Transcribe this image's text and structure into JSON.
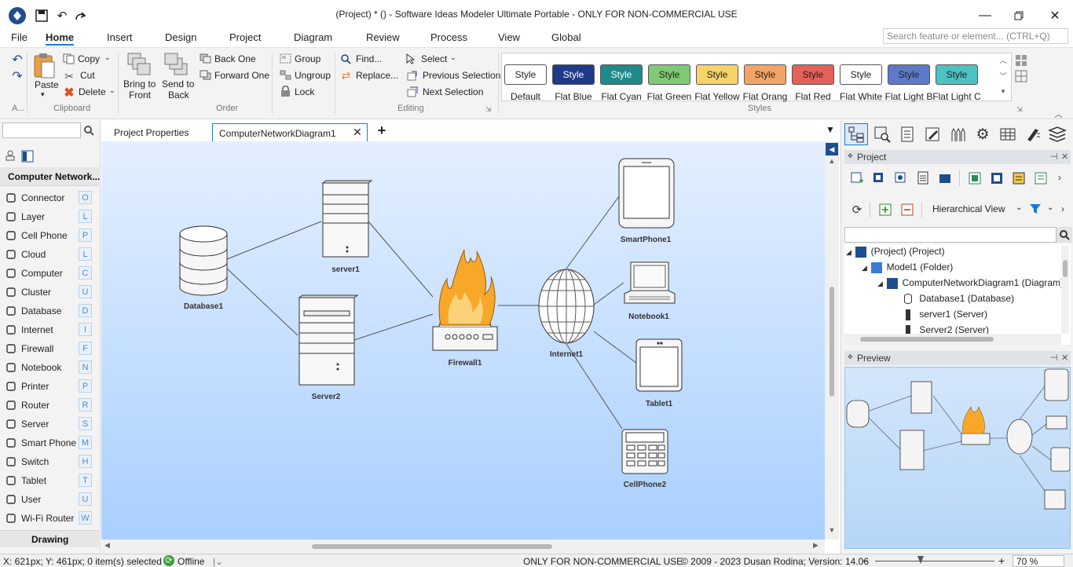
{
  "window": {
    "title": "(Project) *  ()  - Software Ideas Modeler Ultimate Portable - ONLY FOR NON-COMMERCIAL USE",
    "controls": [
      "minimize",
      "maximize",
      "close"
    ]
  },
  "menu": {
    "items": [
      "File",
      "Home",
      "Insert",
      "Design",
      "Project",
      "Diagram",
      "Review",
      "Process",
      "View",
      "Global"
    ],
    "active": "Home",
    "search_placeholder": "Search feature or element... (CTRL+Q)"
  },
  "ribbon": {
    "undo_group_label": "A...",
    "paste_label": "Paste",
    "copy_label": "Copy",
    "cut_label": "Cut",
    "delete_label": "Delete",
    "clipboard_label": "Clipboard",
    "bring_front_label_1": "Bring to",
    "bring_front_label_2": "Front",
    "send_back_label_1": "Send to",
    "send_back_label_2": "Back",
    "back_one_label": "Back One",
    "forward_one_label": "Forward One",
    "group_label": "Group",
    "ungroup_label": "Ungroup",
    "lock_label": "Lock",
    "order_label": "Order",
    "find_label": "Find...",
    "replace_label": "Replace...",
    "select_label": "Select",
    "prev_selection_label": "Previous Selection",
    "next_selection_label": "Next Selection",
    "editing_label": "Editing",
    "styles_label": "Styles",
    "style_button_text": "Style",
    "styles": [
      {
        "name": "Default",
        "bg": "#ffffff",
        "fg": "#222222"
      },
      {
        "name": "Flat Blue",
        "bg": "#203a8a",
        "fg": "#ffffff"
      },
      {
        "name": "Flat Cyan",
        "bg": "#1e8a8a",
        "fg": "#ffffff"
      },
      {
        "name": "Flat Green",
        "bg": "#7fca74",
        "fg": "#222222"
      },
      {
        "name": "Flat Yellow",
        "bg": "#f7d46a",
        "fg": "#222222"
      },
      {
        "name": "Flat Orang",
        "bg": "#f4a366",
        "fg": "#222222"
      },
      {
        "name": "Flat Red",
        "bg": "#e5605a",
        "fg": "#222222"
      },
      {
        "name": "Flat White",
        "bg": "#ffffff",
        "fg": "#222222"
      },
      {
        "name": "Flat Light B",
        "bg": "#5c7ac9",
        "fg": "#222222"
      },
      {
        "name": "Flat Light C",
        "bg": "#4cc2c2",
        "fg": "#222222"
      }
    ]
  },
  "toolbox": {
    "category": "Computer Network...",
    "items": [
      {
        "label": "Connector",
        "key": "O",
        "icon": "connector-icon"
      },
      {
        "label": "Layer",
        "key": "L",
        "icon": "layer-icon"
      },
      {
        "label": "Cell Phone",
        "key": "P",
        "icon": "cell-phone-icon"
      },
      {
        "label": "Cloud",
        "key": "L",
        "icon": "cloud-icon"
      },
      {
        "label": "Computer",
        "key": "C",
        "icon": "computer-icon"
      },
      {
        "label": "Cluster",
        "key": "U",
        "icon": "cluster-icon"
      },
      {
        "label": "Database",
        "key": "D",
        "icon": "database-icon"
      },
      {
        "label": "Internet",
        "key": "I",
        "icon": "internet-icon"
      },
      {
        "label": "Firewall",
        "key": "F",
        "icon": "firewall-icon"
      },
      {
        "label": "Notebook",
        "key": "N",
        "icon": "notebook-icon"
      },
      {
        "label": "Printer",
        "key": "P",
        "icon": "printer-icon"
      },
      {
        "label": "Router",
        "key": "R",
        "icon": "router-icon"
      },
      {
        "label": "Server",
        "key": "S",
        "icon": "server-icon"
      },
      {
        "label": "Smart Phone",
        "key": "M",
        "icon": "smart-phone-icon"
      },
      {
        "label": "Switch",
        "key": "H",
        "icon": "switch-icon"
      },
      {
        "label": "Tablet",
        "key": "T",
        "icon": "tablet-icon"
      },
      {
        "label": "User",
        "key": "U",
        "icon": "user-icon"
      },
      {
        "label": "Wi-Fi Router",
        "key": "W",
        "icon": "wifi-router-icon"
      }
    ],
    "drawing_label": "Drawing"
  },
  "tabs": {
    "items": [
      "Project Properties",
      "ComputerNetworkDiagram1"
    ],
    "active": "ComputerNetworkDiagram1"
  },
  "diagram": {
    "nodes": [
      {
        "id": "database1",
        "label": "Database1"
      },
      {
        "id": "server1",
        "label": "server1"
      },
      {
        "id": "server2",
        "label": "Server2"
      },
      {
        "id": "firewall1",
        "label": "Firewall1"
      },
      {
        "id": "internet1",
        "label": "Internet1"
      },
      {
        "id": "smartphone1",
        "label": "SmartPhone1"
      },
      {
        "id": "notebook1",
        "label": "Notebook1"
      },
      {
        "id": "tablet1",
        "label": "Tablet1"
      },
      {
        "id": "cellphone2",
        "label": "CellPhone2"
      }
    ],
    "edges": [
      [
        "database1",
        "server1"
      ],
      [
        "database1",
        "server2"
      ],
      [
        "server1",
        "firewall1"
      ],
      [
        "server2",
        "firewall1"
      ],
      [
        "firewall1",
        "internet1"
      ],
      [
        "internet1",
        "smartphone1"
      ],
      [
        "internet1",
        "notebook1"
      ],
      [
        "internet1",
        "tablet1"
      ],
      [
        "internet1",
        "cellphone2"
      ]
    ]
  },
  "project_panel": {
    "title": "Project",
    "view_label": "Hierarchical View",
    "tree": [
      "(Project) (Project)",
      "Model1 (Folder)",
      "ComputerNetworkDiagram1 (Diagram)",
      "Database1 (Database)",
      "server1 (Server)",
      "Server2 (Server)"
    ]
  },
  "preview_panel": {
    "title": "Preview"
  },
  "status": {
    "coords": "X: 621px; Y: 461px; 0 item(s) selected",
    "connection": "Offline",
    "notice": "ONLY FOR NON-COMMERCIAL USE",
    "copyright": "© 2009 - 2023 Dusan Rodina; Version: 14.06",
    "zoom": "70 %"
  }
}
